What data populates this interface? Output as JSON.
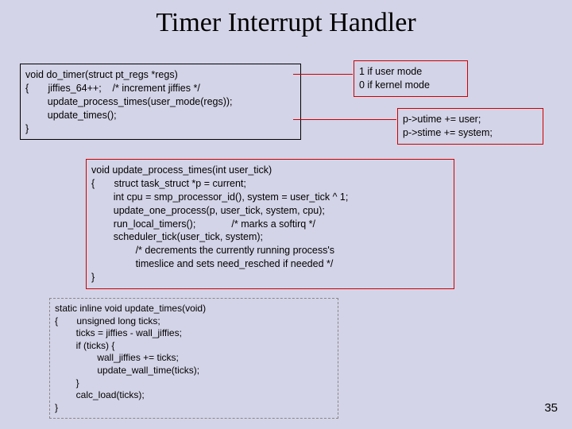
{
  "title": "Timer Interrupt Handler",
  "box1": "void do_timer(struct pt_regs *regs)\n{       jiffies_64++;    /* increment jiffies */\n        update_process_times(user_mode(regs));\n        update_times();\n}",
  "anno1": "1 if user mode\n0 if kernel mode",
  "anno2": "p->utime += user;\np->stime += system;",
  "box2": "void update_process_times(int user_tick)\n{       struct task_struct *p = current;\n        int cpu = smp_processor_id(), system = user_tick ^ 1;\n        update_one_process(p, user_tick, system, cpu);\n        run_local_timers();             /* marks a softirq */\n        scheduler_tick(user_tick, system);\n                /* decrements the currently running process's\n                timeslice and sets need_resched if needed */\n}",
  "box3": "static inline void update_times(void)\n{       unsigned long ticks;\n        ticks = jiffies - wall_jiffies;\n        if (ticks) {\n                wall_jiffies += ticks;\n                update_wall_time(ticks);\n        }\n        calc_load(ticks);\n}",
  "pagenum": "35"
}
